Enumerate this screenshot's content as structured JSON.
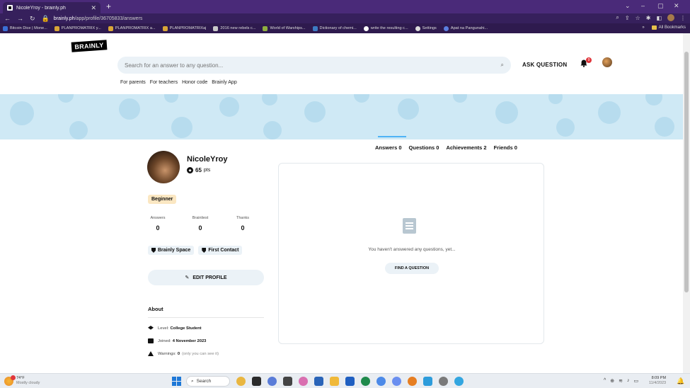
{
  "browser": {
    "tab_title": "NicoleYroy - brainly.ph",
    "url_host": "brainly.ph",
    "url_path": "/app/profile/36705833/answers",
    "bookmarks": [
      "Bitcoin Dice | Mone...",
      "PLANPROMATRIX y...",
      "PLANPROMATRIX a...",
      "PLANPROMATRIXaj",
      "2016 new rebels c...",
      "World of Warships...",
      "Dictionary of chemi...",
      "write the resulting c...",
      "Settings",
      "Apat na Pangunahi..."
    ],
    "all_bookmarks": "All Bookmarks"
  },
  "header": {
    "logo": "BRAINLY",
    "search_placeholder": "Search for an answer to any question...",
    "ask_question": "ASK QUESTION",
    "notif_count": "9"
  },
  "subnav": [
    "For parents",
    "For teachers",
    "Honor code",
    "Brainly App"
  ],
  "profile_tabs": [
    "Answers 0",
    "Questions 0",
    "Achievements 2",
    "Friends 0"
  ],
  "profile": {
    "username": "NicoleYroy",
    "points": "65",
    "points_unit": "pts",
    "rank": "Beginner",
    "stats": [
      {
        "label": "Answers",
        "value": "0"
      },
      {
        "label": "Brainliest",
        "value": "0"
      },
      {
        "label": "Thanks",
        "value": "0"
      }
    ],
    "badges": [
      "Brainly Space",
      "First Contact"
    ],
    "edit_label": "EDIT PROFILE",
    "about_title": "About",
    "about": {
      "level_label": "Level:",
      "level_value": "College Student",
      "joined_label": "Joined:",
      "joined_value": "4 November 2023",
      "warnings_label": "Warnings:",
      "warnings_value": "0",
      "warnings_note": "(only you can see it)"
    }
  },
  "content": {
    "empty_message": "You haven't answered any questions, yet...",
    "find_button": "FIND A QUESTION"
  },
  "taskbar": {
    "temp": "74°F",
    "weather": "Mostly cloudy",
    "search": "Search",
    "time": "8:09 PM",
    "date": "11/4/2023"
  }
}
